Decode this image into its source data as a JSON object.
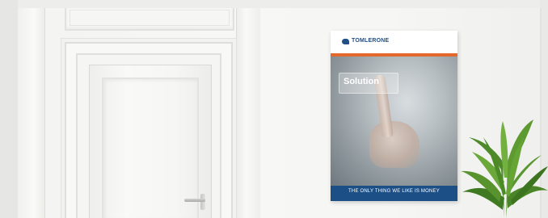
{
  "poster": {
    "brand": "TOMLERONE",
    "headline": "Solution",
    "tagline": "THE ONLY THING WE LIKE IS MONEY",
    "colors": {
      "brand_blue": "#1d4f87",
      "accent_orange": "#e4682b"
    }
  },
  "scene": {
    "icons": [
      "door-handle-icon",
      "plant-icon",
      "logo-icon"
    ]
  }
}
